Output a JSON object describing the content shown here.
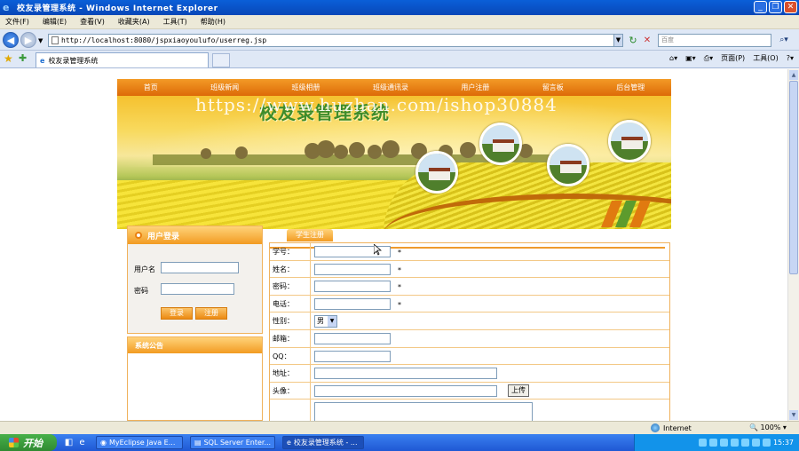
{
  "window": {
    "title": "校友录管理系统 - Windows Internet Explorer"
  },
  "menu": [
    "文件(F)",
    "编辑(E)",
    "查看(V)",
    "收藏夹(A)",
    "工具(T)",
    "帮助(H)"
  ],
  "address": {
    "url": "http://localhost:8080/jspxiaoyoulufo/userreg.jsp",
    "search_placeholder": "百度"
  },
  "tab": {
    "label": "校友录管理系统"
  },
  "commands": {
    "page": "页面(P)",
    "tools": "工具(O)"
  },
  "site": {
    "nav": [
      "首页",
      "班级新闻",
      "班级相册",
      "班级通讯录",
      "用户注册",
      "留言板",
      "后台管理"
    ],
    "banner_title": "校友录管理系统",
    "watermark": "https://www.huzhan.com/ishop30884"
  },
  "login": {
    "header": "用户登录",
    "username_label": "用户名",
    "password_label": "密码",
    "login_button": "登录",
    "register_button": "注册"
  },
  "notice": {
    "header": "系统公告"
  },
  "register": {
    "tab_label": "学生注册",
    "fields": [
      {
        "label": "学号：",
        "required": "*"
      },
      {
        "label": "姓名：",
        "required": "*"
      },
      {
        "label": "密码：",
        "required": "*"
      },
      {
        "label": "电话：",
        "required": "*"
      },
      {
        "label": "性别：",
        "value": "男"
      },
      {
        "label": "邮箱："
      },
      {
        "label": "QQ："
      },
      {
        "label": "地址："
      },
      {
        "label": "头像：",
        "button": "上传"
      }
    ]
  },
  "status": {
    "zone": "Internet",
    "zoom": "100%"
  },
  "taskbar": {
    "start": "开始",
    "items": [
      "MyEclipse Java E...",
      "SQL Server Enter...",
      "校友录管理系统 - ..."
    ],
    "clock": "15:37"
  }
}
